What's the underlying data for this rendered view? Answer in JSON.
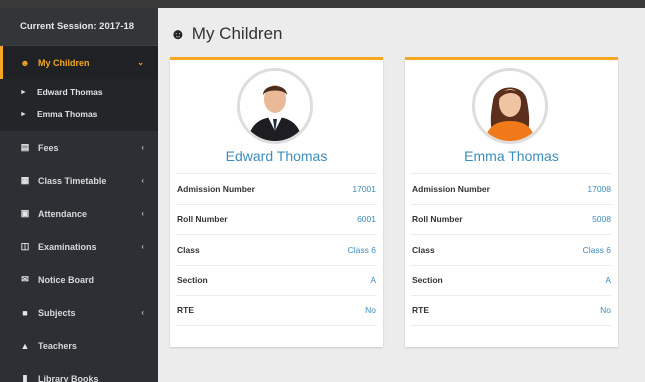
{
  "sidebar": {
    "session": "Current Session: 2017-18",
    "active": {
      "label": "My Children",
      "icon": "users-icon"
    },
    "children": [
      {
        "label": "Edward Thomas"
      },
      {
        "label": "Emma Thomas"
      }
    ],
    "items": [
      {
        "label": "Fees",
        "icon": "money-icon",
        "has_submenu": true
      },
      {
        "label": "Class Timetable",
        "icon": "calendar-icon",
        "has_submenu": true
      },
      {
        "label": "Attendance",
        "icon": "calendar-check-icon",
        "has_submenu": true
      },
      {
        "label": "Examinations",
        "icon": "map-icon",
        "has_submenu": true
      },
      {
        "label": "Notice Board",
        "icon": "envelope-icon",
        "has_submenu": false
      },
      {
        "label": "Subjects",
        "icon": "book-icon",
        "has_submenu": true
      },
      {
        "label": "Teachers",
        "icon": "user-icon",
        "has_submenu": false
      },
      {
        "label": "Library Books",
        "icon": "book-open-icon",
        "has_submenu": false
      }
    ]
  },
  "main": {
    "title": "My Children",
    "cards": [
      {
        "name": "Edward Thomas",
        "rows": [
          {
            "label": "Admission Number",
            "value": "17001"
          },
          {
            "label": "Roll Number",
            "value": "6001"
          },
          {
            "label": "Class",
            "value": "Class 6"
          },
          {
            "label": "Section",
            "value": "A"
          },
          {
            "label": "RTE",
            "value": "No"
          }
        ]
      },
      {
        "name": "Emma Thomas",
        "rows": [
          {
            "label": "Admission Number",
            "value": "17008"
          },
          {
            "label": "Roll Number",
            "value": "5008"
          },
          {
            "label": "Class",
            "value": "Class 6"
          },
          {
            "label": "Section",
            "value": "A"
          },
          {
            "label": "RTE",
            "value": "No"
          }
        ]
      }
    ]
  },
  "colors": {
    "accent": "#f5a623",
    "link": "#3c8dbc",
    "sidebar_bg": "#2c2f33"
  }
}
